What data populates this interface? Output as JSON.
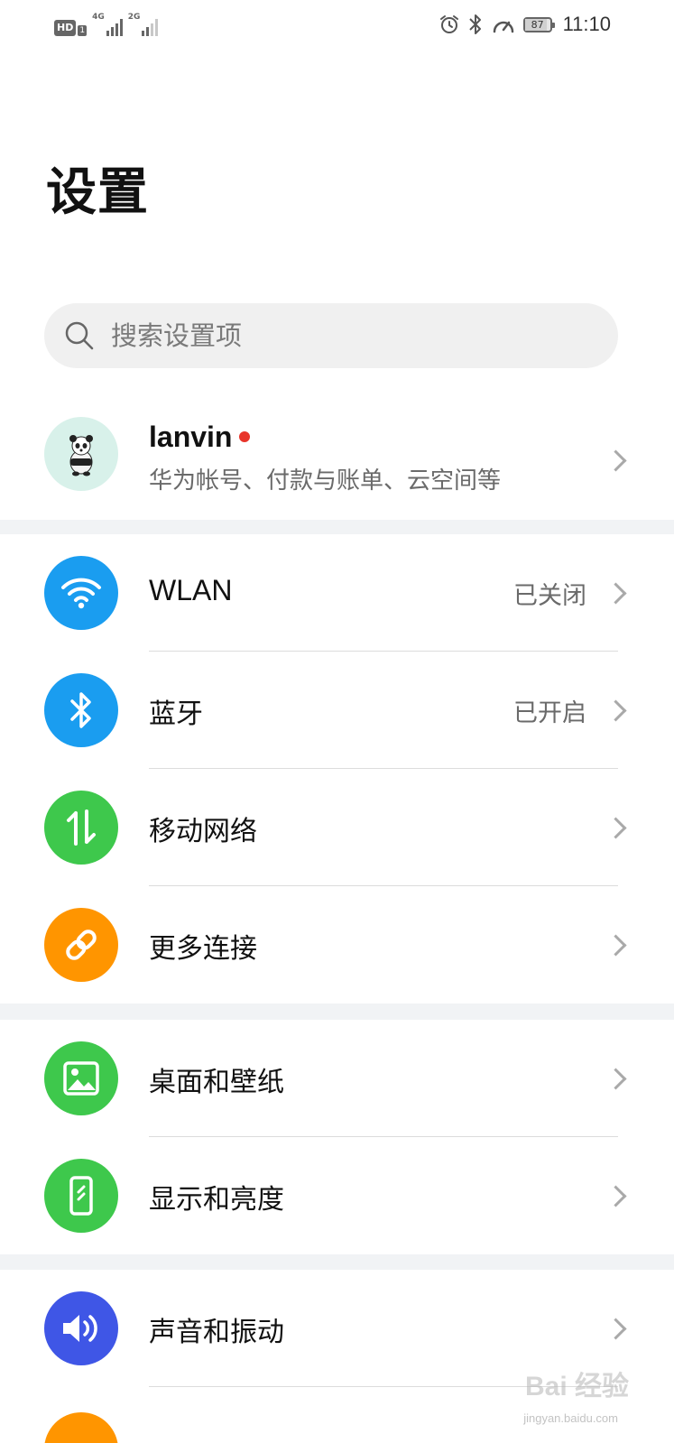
{
  "status_bar": {
    "hd": "HD",
    "sim": "1",
    "net1": "4G",
    "net2": "2G",
    "battery": "87",
    "battery_level": 0.87,
    "time": "11:10",
    "icons": [
      "alarm-icon",
      "bluetooth-icon",
      "speedometer-icon"
    ]
  },
  "header": {
    "title": "设置"
  },
  "search": {
    "placeholder": "搜索设置项"
  },
  "account": {
    "name": "lanvin",
    "subtitle": "华为帐号、付款与账单、云空间等"
  },
  "groups": [
    {
      "items": [
        {
          "label": "WLAN",
          "value": "已关闭",
          "icon": "wifi-icon",
          "color": "#1a9df0"
        },
        {
          "label": "蓝牙",
          "value": "已开启",
          "icon": "bluetooth-icon",
          "color": "#1a9df0"
        },
        {
          "label": "移动网络",
          "value": "",
          "icon": "mobile-data-icon",
          "color": "#3ec84c"
        },
        {
          "label": "更多连接",
          "value": "",
          "icon": "link-icon",
          "color": "#ff9500"
        }
      ]
    },
    {
      "items": [
        {
          "label": "桌面和壁纸",
          "value": "",
          "icon": "image-icon",
          "color": "#3ec84c"
        },
        {
          "label": "显示和亮度",
          "value": "",
          "icon": "phone-brightness-icon",
          "color": "#3ec84c"
        }
      ]
    },
    {
      "items": [
        {
          "label": "声音和振动",
          "value": "",
          "icon": "speaker-icon",
          "color": "#3f56e6"
        }
      ]
    }
  ],
  "watermark": {
    "text": "Bai 经验",
    "sub": "jingyan.baidu.com"
  }
}
